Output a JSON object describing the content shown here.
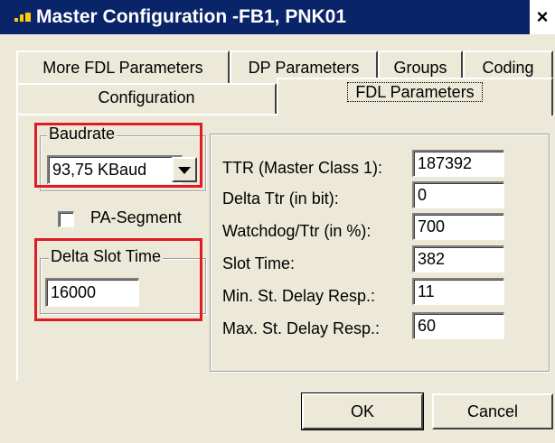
{
  "window": {
    "title": "Master Configuration  -FB1, PNK01",
    "close_label": "×"
  },
  "tabs": {
    "row_back": [
      {
        "label": "More FDL Parameters"
      },
      {
        "label": "DP Parameters"
      },
      {
        "label": "Groups"
      },
      {
        "label": "Coding"
      }
    ],
    "row_front": [
      {
        "label": "Configuration"
      },
      {
        "label": "FDL Parameters"
      }
    ],
    "active": "FDL Parameters"
  },
  "baudrate": {
    "legend": "Baudrate",
    "value": "93,75  KBaud"
  },
  "pa_segment": {
    "label": "PA-Segment",
    "checked": false
  },
  "delta_slot_time": {
    "legend": "Delta Slot Time",
    "value": "16000"
  },
  "params": [
    {
      "label": "TTR (Master Class 1):",
      "value": "187392"
    },
    {
      "label": "Delta Ttr (in bit):",
      "value": "0"
    },
    {
      "label": "Watchdog/Ttr (in %):",
      "value": "700"
    },
    {
      "label": "Slot Time:",
      "value": "382"
    },
    {
      "label": "Min. St. Delay Resp.:",
      "value": "11"
    },
    {
      "label": "Max. St. Delay Resp.:",
      "value": "60"
    }
  ],
  "buttons": {
    "ok": "OK",
    "cancel": "Cancel"
  },
  "colors": {
    "titlebar": "#0a246a",
    "dialog": "#ece9d8",
    "highlight": "#e01b24"
  }
}
